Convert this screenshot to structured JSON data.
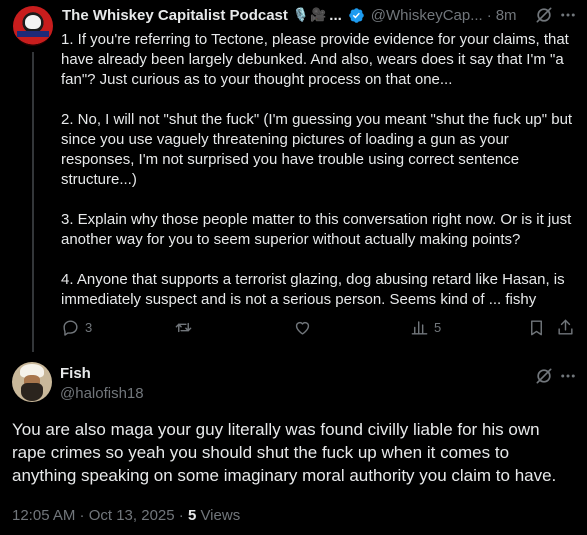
{
  "reply_tweet": {
    "author_name": "The Whiskey Capitalist Podcast",
    "name_emojis": "🎙️🎥",
    "name_ellipsis": "...",
    "handle": "@WhiskeyCap...",
    "separator": "·",
    "time": "8m",
    "paragraphs": [
      "1. If you're referring to Tectone, please provide evidence for your claims, that have already been largely debunked. And also, wears does it say that I'm \"a fan\"? Just curious as to your thought process on that one...",
      "2. No, I will not \"shut the fuck\" (I'm guessing you meant \"shut the fuck up\" but since you use vaguely threatening pictures of loading a gun as your responses, I'm not surprised you have trouble using correct sentence structure...)",
      "3. Explain why those people matter to this conversation right now. Or is it just another way for you to seem superior without actually making points?",
      "4. Anyone that supports a terrorist glazing, dog abusing retard like Hasan, is immediately suspect and is not a serious person. Seems kind of ... fishy"
    ],
    "actions": {
      "reply_count": "3",
      "views_count": "5"
    },
    "icons": [
      "avatar",
      "verified-badge-icon",
      "grok-icon",
      "more-icon",
      "reply-icon",
      "retweet-icon",
      "like-icon",
      "views-icon",
      "bookmark-icon",
      "share-icon"
    ]
  },
  "main_tweet": {
    "author_name": "Fish",
    "handle": "@halofish18",
    "text": "You are also maga your guy literally was found civilly liable for his own rape crimes so yeah you should shut the fuck up when it comes to anything speaking on some imaginary moral authority you claim to have.",
    "timestamp": "12:05 AM · Oct 13, 2025 ·",
    "views_count": "5",
    "views_label": "Views"
  },
  "colors": {
    "background": "#000000",
    "text_primary": "#e7e9ea",
    "text_secondary": "#71767b",
    "verified_blue": "#1d9bf0",
    "thread_line": "#333639"
  }
}
